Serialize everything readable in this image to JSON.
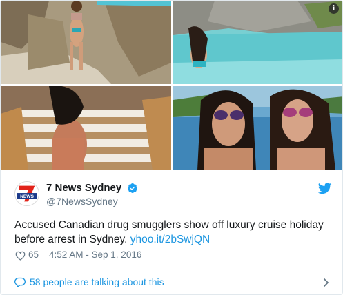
{
  "author": {
    "name": "7 News Sydney",
    "handle": "@7NewsSydney",
    "avatar_text": "NEWS",
    "verified": true
  },
  "tweet": {
    "text": "Accused Canadian drug smugglers show off luxury cruise holiday before arrest in Sydney.",
    "link": "yhoo.it/2bSwjQN",
    "likes": "65",
    "timestamp": "4:52 AM - Sep 1, 2016"
  },
  "conversation": {
    "label": "58 people are talking about this"
  },
  "media": {
    "photos": [
      "bikini-on-rocks",
      "woman-in-turquoise-water",
      "woman-on-ship-stairs",
      "two-women-sunglasses-selfie"
    ],
    "info_icon": "i"
  },
  "colors": {
    "link": "#1b95e0",
    "muted": "#657786",
    "brand_red": "#e2231a",
    "twitter_blue": "#1da1f2"
  },
  "icons": {
    "verified": "verified-badge-icon",
    "bird": "twitter-bird-icon",
    "heart": "heart-icon",
    "bubble": "speech-bubble-icon",
    "chevron": "chevron-right-icon"
  }
}
